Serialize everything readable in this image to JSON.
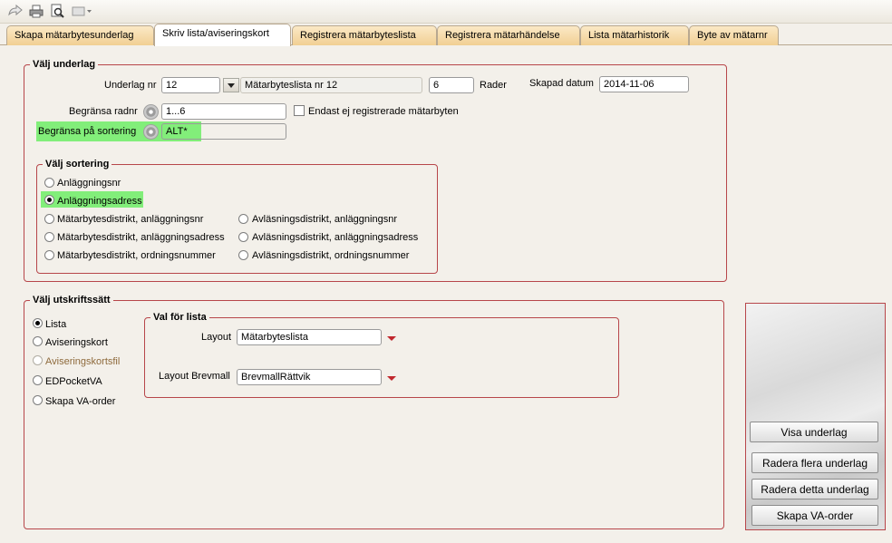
{
  "toolbar": {
    "icons": [
      "forward-arrow-icon",
      "printer-icon",
      "print-preview-icon",
      "export-dropdown-icon"
    ]
  },
  "tabs": [
    {
      "label": "Skapa mätarbytesunderlag"
    },
    {
      "label": "Skriv lista/aviseringskort",
      "active": true
    },
    {
      "label": "Registrera mätarbyteslista"
    },
    {
      "label": "Registrera mätarhändelse"
    },
    {
      "label": "Lista mätarhistorik"
    },
    {
      "label": "Byte av mätarnr"
    }
  ],
  "valj_underlag": {
    "legend": "Välj underlag",
    "underlag_nr_label": "Underlag nr",
    "underlag_nr_value": "12",
    "underlag_name": "Mätarbyteslista nr 12",
    "rader_value": "6",
    "rader_label": "Rader",
    "skapad_label": "Skapad datum",
    "skapad_value": "2014-11-06",
    "begransa_radnr_label": "Begränsa radnr",
    "begransa_radnr_value": "1...6",
    "endast_label": "Endast ej registrerade mätarbyten",
    "begransa_sort_label": "Begränsa på sortering",
    "begransa_sort_value": "ALT*"
  },
  "valj_sortering": {
    "legend": "Välj sortering",
    "options": [
      "Anläggningsnr",
      "Anläggningsadress",
      "Mätarbytesdistrikt, anläggningsnr",
      "Mätarbytesdistrikt, anläggningsadress",
      "Mätarbytesdistrikt, ordningsnummer",
      "Avläsningsdistrikt, anläggningsnr",
      "Avläsningsdistrikt, anläggningsadress",
      "Avläsningsdistrikt, ordningsnummer"
    ],
    "selected": "Anläggningsadress"
  },
  "valj_utskriftssatt": {
    "legend": "Välj utskriftssätt",
    "options": [
      "Lista",
      "Aviseringskort",
      "Aviseringskortsfil",
      "EDPocketVA",
      "Skapa VA-order"
    ],
    "selected": "Lista",
    "disabled": "Aviseringskortsfil"
  },
  "val_for_lista": {
    "legend": "Val för lista",
    "layout_label": "Layout",
    "layout_value": "Mätarbyteslista",
    "brevmall_label": "Layout Brevmall",
    "brevmall_value": "BrevmallRättvik"
  },
  "actions": {
    "visa": "Visa underlag",
    "radera_flera": "Radera flera underlag",
    "radera_detta": "Radera detta underlag",
    "skapa_va": "Skapa VA-order"
  },
  "colors": {
    "group_border": "#b7464a",
    "highlight": "#82ee7a",
    "tab_bg": "#f1cf93"
  }
}
